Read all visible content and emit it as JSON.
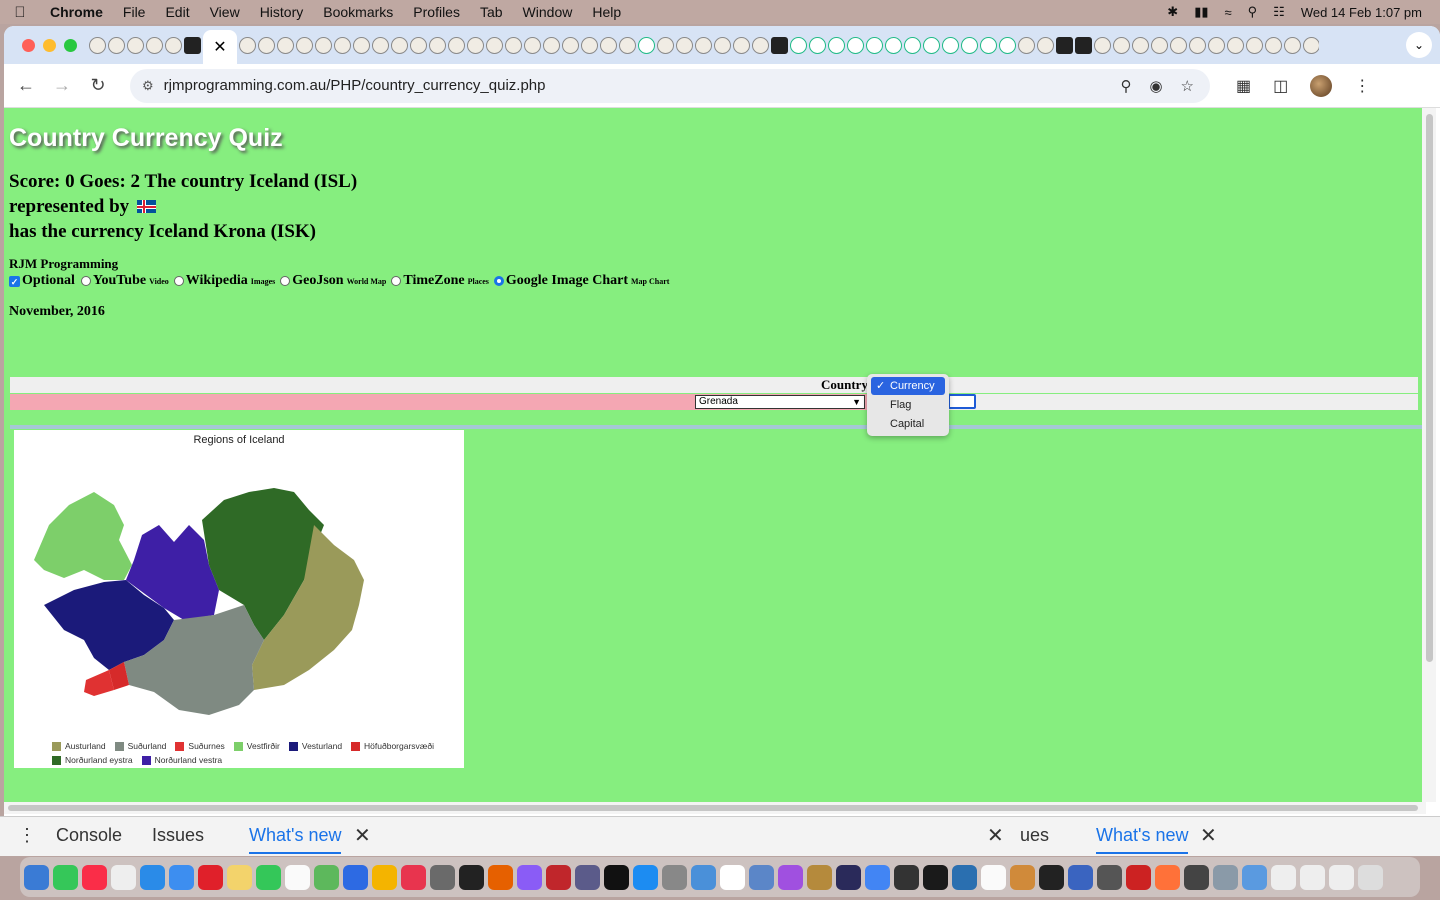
{
  "menubar": {
    "app": "Chrome",
    "items": [
      "File",
      "Edit",
      "View",
      "History",
      "Bookmarks",
      "Profiles",
      "Tab",
      "Window",
      "Help"
    ],
    "clock": "Wed 14 Feb  1:07 pm"
  },
  "browser": {
    "url": "rjmprogramming.com.au/PHP/country_currency_quiz.php"
  },
  "page": {
    "title": "Country Currency Quiz",
    "score_line1": "Score: 0 Goes: 2 The country Iceland (ISL)",
    "score_line2": "represented by",
    "score_line3": "has the currency Iceland Krona (ISK)",
    "brand": "RJM Programming",
    "options": [
      {
        "label": "Optional",
        "small": ""
      },
      {
        "label": "YouTube",
        "small": "Video"
      },
      {
        "label": "Wikipedia",
        "small": "Images"
      },
      {
        "label": "GeoJson",
        "small": "World Map"
      },
      {
        "label": "TimeZone",
        "small": "Places"
      },
      {
        "label": "Google Image Chart",
        "small": "Map Chart"
      }
    ],
    "date": "November, 2016",
    "country_label": "Country",
    "country_select_value": "Grenada",
    "dropdown_options": [
      "Currency",
      "Flag",
      "Capital"
    ],
    "dropdown_selected": "Currency"
  },
  "chart": {
    "title": "Regions of Iceland",
    "legend": [
      {
        "name": "Austurland",
        "color": "#9a9a5a"
      },
      {
        "name": "Suðurland",
        "color": "#7f8a82"
      },
      {
        "name": "Suðurnes",
        "color": "#e03232"
      },
      {
        "name": "Vestfirðir",
        "color": "#7dcf6a"
      },
      {
        "name": "Vesturland",
        "color": "#1b1a7a"
      },
      {
        "name": "Höfuðborgarsvæði",
        "color": "#d62a2a"
      },
      {
        "name": "Norðurland eystra",
        "color": "#2f6a26"
      },
      {
        "name": "Norðurland vestra",
        "color": "#3e1fa6"
      }
    ]
  },
  "devtools": {
    "console": "Console",
    "issues": "Issues",
    "whats_new": "What's new",
    "issues_partial": "ues",
    "whats_new_2": "What's new"
  }
}
